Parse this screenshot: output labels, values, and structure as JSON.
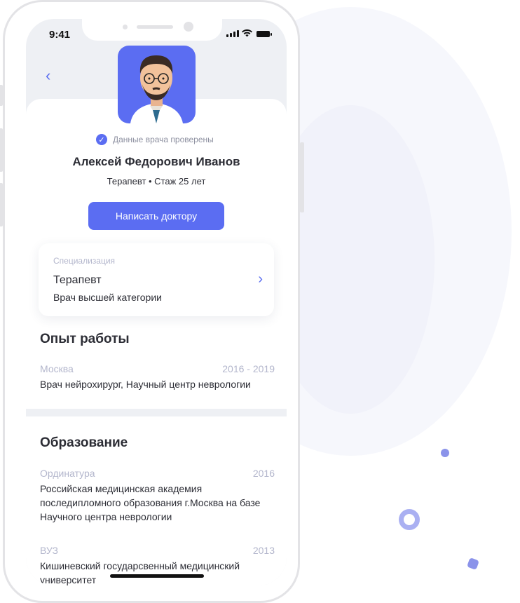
{
  "status_bar": {
    "time": "9:41"
  },
  "doctor": {
    "verified_text": "Данные врача проверены",
    "name": "Алексей Федорович Иванов",
    "subtitle": "Терапевт • Стаж 25 лет",
    "write_button": "Написать доктору"
  },
  "specialization": {
    "label": "Специализация",
    "title": "Терапевт",
    "description": "Врач высшей категории"
  },
  "experience": {
    "title": "Опыт работы",
    "items": [
      {
        "city": "Москва",
        "years": "2016 - 2019",
        "text": "Врач нейрохирург, Научный центр неврологии"
      }
    ]
  },
  "education": {
    "title": "Образование",
    "items": [
      {
        "type": "Ординатура",
        "year": "2016",
        "text": "Российская медицинская академия последипломного образования г.Москва на базе Научного центра неврологии"
      },
      {
        "type": "ВУЗ",
        "year": "2013",
        "text": "Кишиневский государсвенный медицинский университет"
      }
    ]
  },
  "colors": {
    "accent": "#5b6df2",
    "muted": "#b3b6cc",
    "text": "#2c2d35"
  },
  "icons": {
    "back": "chevron-left-icon",
    "verified": "check-circle-icon",
    "spec_arrow": "chevron-right-icon"
  }
}
